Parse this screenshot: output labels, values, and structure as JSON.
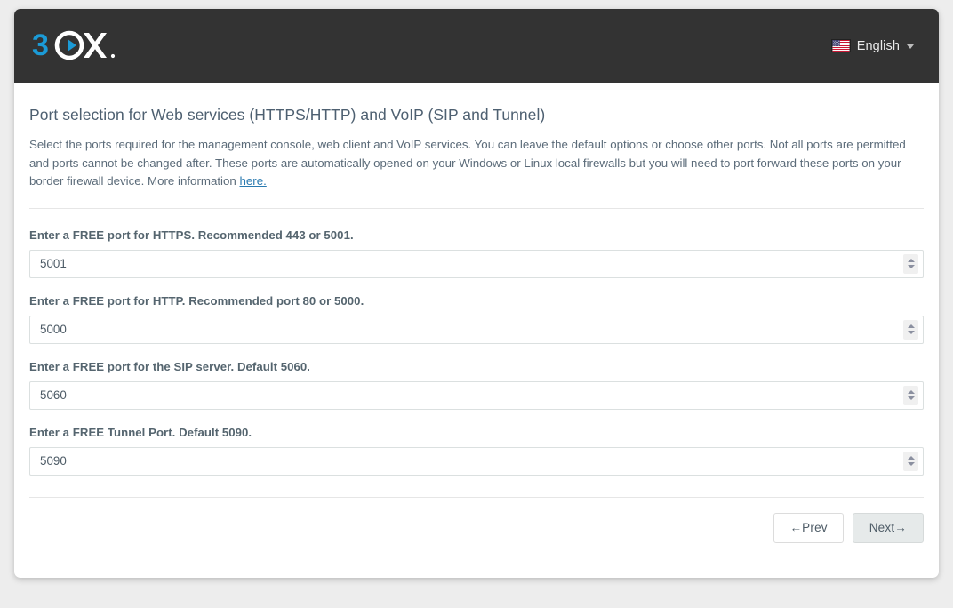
{
  "header": {
    "logo_text": "3CX",
    "logo_colors": {
      "digit": "#1b9bd7",
      "letters": "#ffffff"
    },
    "language": {
      "label": "English",
      "flag_icon": "us-flag-icon",
      "caret_icon": "chevron-down-icon"
    }
  },
  "main": {
    "title": "Port selection for Web services (HTTPS/HTTP) and VoIP (SIP and Tunnel)",
    "intro_before_link": "Select the ports required for the management console, web client and VoIP services. You can leave the default options or choose other ports. Not all ports are permitted and ports cannot be changed after. These ports are automatically opened on your Windows or Linux local firewalls but you will need to port forward these ports on your border firewall device. More information ",
    "intro_link": "here.",
    "fields": [
      {
        "label": "Enter a FREE port for HTTPS. Recommended 443 or 5001.",
        "value": "5001",
        "name": "https-port"
      },
      {
        "label": "Enter a FREE port for HTTP. Recommended port 80 or 5000.",
        "value": "5000",
        "name": "http-port"
      },
      {
        "label": "Enter a FREE port for the SIP server. Default 5060.",
        "value": "5060",
        "name": "sip-port"
      },
      {
        "label": "Enter a FREE Tunnel Port. Default 5090.",
        "value": "5090",
        "name": "tunnel-port"
      }
    ]
  },
  "footer": {
    "prev_label": "←Prev",
    "next_label": "Next→"
  },
  "colors": {
    "header_bg": "#333333",
    "page_bg": "#ededed",
    "link": "#2a7ab0",
    "title_text": "#4e6071",
    "body_text": "#5b6b79"
  }
}
